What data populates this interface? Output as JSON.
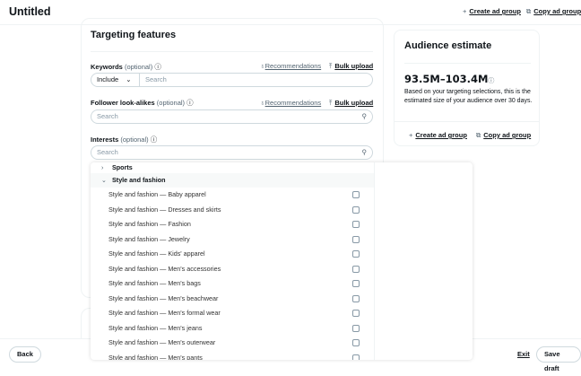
{
  "header": {
    "title": "Untitled",
    "create_ad_group": "Create ad group",
    "copy_ad_group": "Copy ad group"
  },
  "targeting": {
    "title": "Targeting features",
    "keywords": {
      "label": "Keywords",
      "optional": "(optional)",
      "recommendations": "Recommendations",
      "bulk_upload": "Bulk upload",
      "match": "Include",
      "placeholder": "Search"
    },
    "lookalikes": {
      "label": "Follower look-alikes",
      "optional": "(optional)",
      "recommendations": "Recommendations",
      "bulk_upload": "Bulk upload",
      "placeholder": "Search"
    },
    "interests": {
      "label": "Interests",
      "optional": "(optional)",
      "placeholder": "Search"
    }
  },
  "dropdown": {
    "categories": [
      {
        "label": "Sports",
        "expanded": false
      },
      {
        "label": "Style and fashion",
        "expanded": true
      }
    ],
    "items": [
      "Style and fashion — Baby apparel",
      "Style and fashion — Dresses and skirts",
      "Style and fashion — Fashion",
      "Style and fashion — Jewelry",
      "Style and fashion — Kids' apparel",
      "Style and fashion — Men's accessories",
      "Style and fashion — Men's bags",
      "Style and fashion — Men's beachwear",
      "Style and fashion — Men's formal wear",
      "Style and fashion — Men's jeans",
      "Style and fashion — Men's outerwear",
      "Style and fashion — Men's pants"
    ]
  },
  "audience": {
    "title": "Audience estimate",
    "range": "93.5M–103.4M",
    "description": "Based on your targeting selections, this is the estimated size of your audience over 30 days.",
    "create_ad_group": "Create ad group",
    "copy_ad_group": "Copy ad group"
  },
  "footer": {
    "back": "Back",
    "exit": "Exit",
    "save_draft": "Save draft"
  }
}
